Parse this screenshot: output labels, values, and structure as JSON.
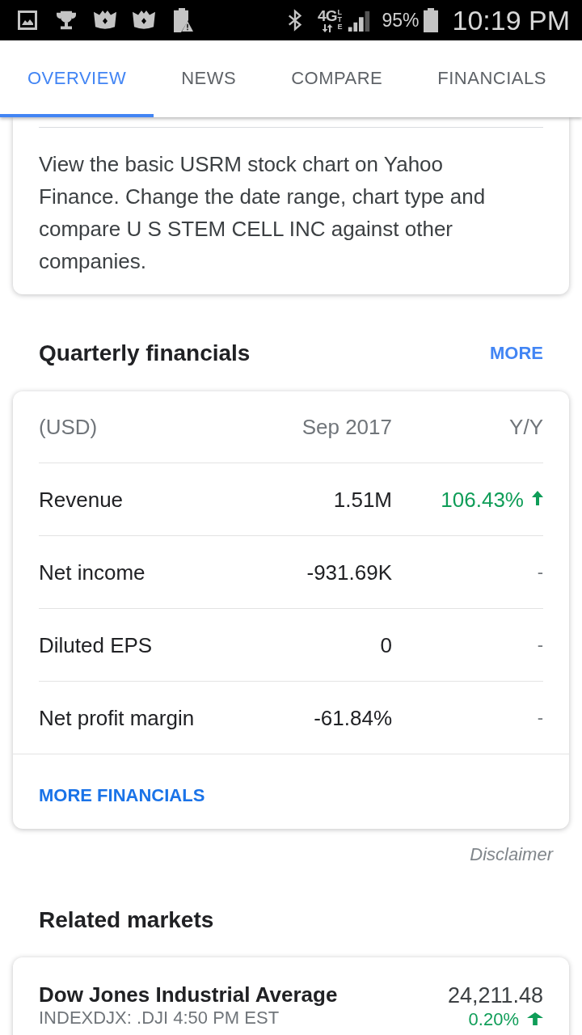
{
  "status_bar": {
    "network": "4G",
    "network_sub": "LTE",
    "battery": "95%",
    "time": "10:19 PM"
  },
  "tabs": [
    {
      "label": "OVERVIEW",
      "selected": true
    },
    {
      "label": "NEWS",
      "selected": false
    },
    {
      "label": "COMPARE",
      "selected": false
    },
    {
      "label": "FINANCIALS",
      "selected": false
    }
  ],
  "about_card": {
    "description": "View the basic USRM stock chart on Yahoo Finance. Change the date range, chart type and compare U S STEM CELL INC against other companies."
  },
  "quarterly_financials": {
    "title": "Quarterly financials",
    "more_link": "MORE",
    "columns": [
      "(USD)",
      "Sep 2017",
      "Y/Y"
    ],
    "rows": [
      {
        "kind": "up",
        "label": "Revenue",
        "value": "1.51M",
        "change": "106.43%"
      },
      {
        "kind": "flat",
        "label": "Net income",
        "value": "-931.69K",
        "change": "-"
      },
      {
        "kind": "flat",
        "label": "Diluted EPS",
        "value": "0",
        "change": "-"
      },
      {
        "kind": "flat",
        "label": "Net profit margin",
        "value": "-61.84%",
        "change": "-"
      }
    ],
    "footer_link": "MORE FINANCIALS",
    "disclaimer": "Disclaimer"
  },
  "related_markets": {
    "title": "Related markets",
    "items": [
      {
        "kind": "up",
        "name": "Dow Jones Industrial Average",
        "detail": "INDEXDJX: .DJI 4:50 PM EST",
        "price": "24,211.48",
        "change": "0.20%"
      }
    ]
  }
}
